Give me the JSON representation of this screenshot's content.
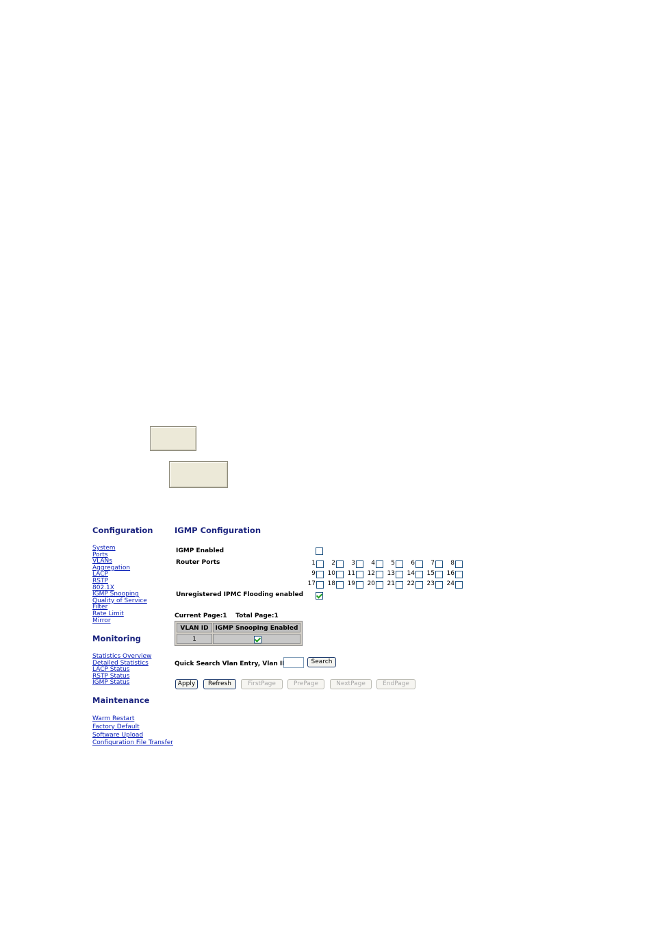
{
  "sidebar": {
    "configuration": {
      "title": "Configuration",
      "items": [
        "System",
        "Ports",
        "VLANs",
        "Aggregation",
        "LACP",
        "RSTP",
        "802.1X",
        "IGMP Snooping",
        "Quality of Service",
        "Filter",
        "Rate Limit",
        "Mirror"
      ]
    },
    "monitoring": {
      "title": "Monitoring",
      "items": [
        "Statistics Overview",
        "Detailed Statistics",
        "LACP Status",
        "RSTP Status",
        "IGMP Status"
      ]
    },
    "maintenance": {
      "title": "Maintenance",
      "items": [
        "Warm Restart",
        "Factory Default",
        "Software Upload",
        "Configuration File Transfer"
      ]
    }
  },
  "main": {
    "title": "IGMP Configuration",
    "igmp_enabled_label": "IGMP Enabled",
    "igmp_enabled": false,
    "router_ports_label": "Router Ports",
    "router_ports": [
      {
        "num": "1",
        "checked": false
      },
      {
        "num": "2",
        "checked": false
      },
      {
        "num": "3",
        "checked": false
      },
      {
        "num": "4",
        "checked": false
      },
      {
        "num": "5",
        "checked": false
      },
      {
        "num": "6",
        "checked": false
      },
      {
        "num": "7",
        "checked": false
      },
      {
        "num": "8",
        "checked": false
      },
      {
        "num": "9",
        "checked": false
      },
      {
        "num": "10",
        "checked": false
      },
      {
        "num": "11",
        "checked": false
      },
      {
        "num": "12",
        "checked": false
      },
      {
        "num": "13",
        "checked": false
      },
      {
        "num": "14",
        "checked": false
      },
      {
        "num": "15",
        "checked": false
      },
      {
        "num": "16",
        "checked": false
      },
      {
        "num": "17",
        "checked": false
      },
      {
        "num": "18",
        "checked": false
      },
      {
        "num": "19",
        "checked": false
      },
      {
        "num": "20",
        "checked": false
      },
      {
        "num": "21",
        "checked": false
      },
      {
        "num": "22",
        "checked": false
      },
      {
        "num": "23",
        "checked": false
      },
      {
        "num": "24",
        "checked": false
      }
    ],
    "flooding_label": "Unregistered IPMC Flooding enabled",
    "flooding_enabled": true,
    "pagination": "Current Page:1    Total Page:1",
    "table": {
      "headers": [
        "VLAN ID",
        "IGMP Snooping Enabled"
      ],
      "rows": [
        {
          "vlan_id": "1",
          "snooping_enabled": true
        }
      ]
    },
    "search": {
      "label": "Quick Search Vlan Entry, Vlan ID:",
      "value": "",
      "button": "Search"
    },
    "buttons": {
      "apply": "Apply",
      "refresh": "Refresh",
      "first": "FirstPage",
      "prev": "PrePage",
      "next": "NextPage",
      "end": "EndPage"
    }
  },
  "colors": {
    "heading": "#1a237e",
    "link": "#0a1fb8",
    "checkbox_border": "#1c5180",
    "check_mark": "#21a121"
  }
}
